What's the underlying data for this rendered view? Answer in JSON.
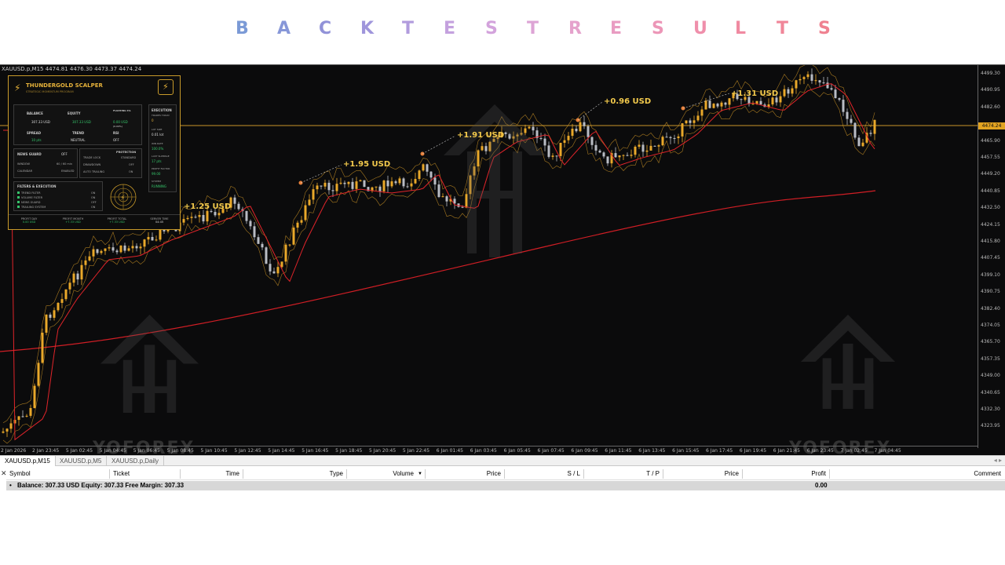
{
  "banner": {
    "letters": [
      {
        "char": "B",
        "color": "#7b9ad6"
      },
      {
        "char": "A",
        "color": "#8797d8"
      },
      {
        "char": "C",
        "color": "#9192d8"
      },
      {
        "char": "K",
        "color": "#9f95db"
      },
      {
        "char": "T",
        "color": "#b19bdd"
      },
      {
        "char": "E",
        "color": "#c4a1de"
      },
      {
        "char": "S",
        "color": "#d3a3dc"
      },
      {
        "char": "T",
        "color": "#dda4d5"
      },
      {
        "char": "R",
        "color": "#e5a2cc"
      },
      {
        "char": "E",
        "color": "#e99cc2"
      },
      {
        "char": "S",
        "color": "#ec96b7"
      },
      {
        "char": "U",
        "color": "#ef8fab"
      },
      {
        "char": "L",
        "color": "#f08aa1"
      },
      {
        "char": "T",
        "color": "#f08699"
      },
      {
        "char": "S",
        "color": "#ef8190"
      }
    ]
  },
  "chart": {
    "info": "XAUUSD.p,M15  4474.81 4476.30 4473.37 4474.24",
    "current_price": "4474.24",
    "price_labels": [
      "4499.30",
      "4490.95",
      "4482.60",
      "4474.24",
      "4465.90",
      "4457.55",
      "4449.20",
      "4440.85",
      "4432.50",
      "4424.15",
      "4415.80",
      "4407.45",
      "4399.10",
      "4390.75",
      "4382.40",
      "4374.05",
      "4365.70",
      "4357.35",
      "4349.00",
      "4340.65",
      "4332.30",
      "4323.95"
    ],
    "time_labels": [
      "2 Jan 2026",
      "2 Jan 23:45",
      "5 Jan 02:45",
      "5 Jan 04:45",
      "5 Jan 06:45",
      "5 Jan 08:45",
      "5 Jan 10:45",
      "5 Jan 12:45",
      "5 Jan 14:45",
      "5 Jan 16:45",
      "5 Jan 18:45",
      "5 Jan 20:45",
      "5 Jan 22:45",
      "6 Jan 01:45",
      "6 Jan 03:45",
      "6 Jan 05:45",
      "6 Jan 07:45",
      "6 Jan 09:45",
      "6 Jan 11:45",
      "6 Jan 13:45",
      "6 Jan 15:45",
      "6 Jan 17:45",
      "6 Jan 19:45",
      "6 Jan 21:45",
      "6 Jan 23:45",
      "7 Jan 02:45",
      "7 Jan 04:45"
    ],
    "trade_labels": [
      "+1.25 USD",
      "+1.95 USD",
      "+1.91 USD",
      "+0.96 USD",
      "+1.31 USD"
    ],
    "watermarks": [
      "YOFOREX",
      "YOFOREX"
    ],
    "colors": {
      "bull": "#e9a82a",
      "bear": "#b9bcc4",
      "ma_fast": "#e0242a",
      "ma_slow": "#d01e25",
      "band": "#e9a82a",
      "current_line": "#c8962a"
    }
  },
  "ea_panel": {
    "title": "THUNDERGOLD SCALPER",
    "subtitle": "STRATEGIC MOMENTUM PROGRAM",
    "balance_label": "BALANCE",
    "balance_value": "307.33 USD",
    "equity_label": "EQUITY",
    "equity_value": "307.33 USD",
    "floating_label": "FLOATING P/L",
    "floating_value": "0.00 USD",
    "floating_pct": "(0.00%)",
    "spread_label": "SPREAD",
    "spread_value": "10 pts",
    "trend_label": "TREND",
    "trend_value": "NEUTRAL",
    "rsi_label": "RSI",
    "rsi_value": "OFF",
    "execution_label": "EXECUTION",
    "execution_sub": "TRADES TODAY",
    "execution_value": "0",
    "lot_label": "LOT SIZE",
    "lot_value": "0.01 lot",
    "winrate_label": "WIN RATE",
    "winrate_value": "100.0%",
    "slippage_label": "LAST SLIPPAGE",
    "slippage_value": "17 pts",
    "factor_label": "PROFIT FACTOR",
    "factor_value": "99.00",
    "system_label": "SYSTEM",
    "system_value": "RUNNING",
    "news_label": "NEWS GUARD",
    "news_value": "OFF",
    "news_rows": [
      "WINDOW",
      "CALENDAR"
    ],
    "news_values": [
      "60 / 60 min",
      "ENABLED"
    ],
    "protection_label": "PROTECTION",
    "protection_value": "STANDARD",
    "protection_rows": [
      "TRADE LOCK",
      "DRAWDOWN",
      "AUTO TRAILING"
    ],
    "protection_values": [
      "OFF",
      "OFF",
      "ON"
    ],
    "filters_label": "FILTERS & EXECUTION",
    "filters": [
      "TREND FILTER",
      "VOLUME FILTER",
      "NEWS GUARD",
      "TRAILING SYSTEM"
    ],
    "filter_values": [
      "ON",
      "ON",
      "OFF",
      "ON"
    ],
    "footer": [
      {
        "label": "PROFIT DAY",
        "value": "0.00 USD"
      },
      {
        "label": "PROFIT MONTH",
        "value": "+7.33 USD"
      },
      {
        "label": "PROFIT TOTAL",
        "value": "+7.33 USD"
      },
      {
        "label": "SERVER TIME",
        "value": "04:45"
      }
    ]
  },
  "tabs": [
    "XAUUSD.p,M15",
    "XAUUSD.p,M5",
    "XAUUSD.p,Daily"
  ],
  "terminal": {
    "columns": [
      "Symbol",
      "Ticket",
      "Time",
      "Type",
      "Volume",
      "Price",
      "S / L",
      "T / P",
      "Price",
      "Profit",
      "Comment"
    ],
    "summary": "Balance: 307.33 USD  Equity: 307.33  Free Margin: 307.33",
    "profit": "0.00"
  }
}
